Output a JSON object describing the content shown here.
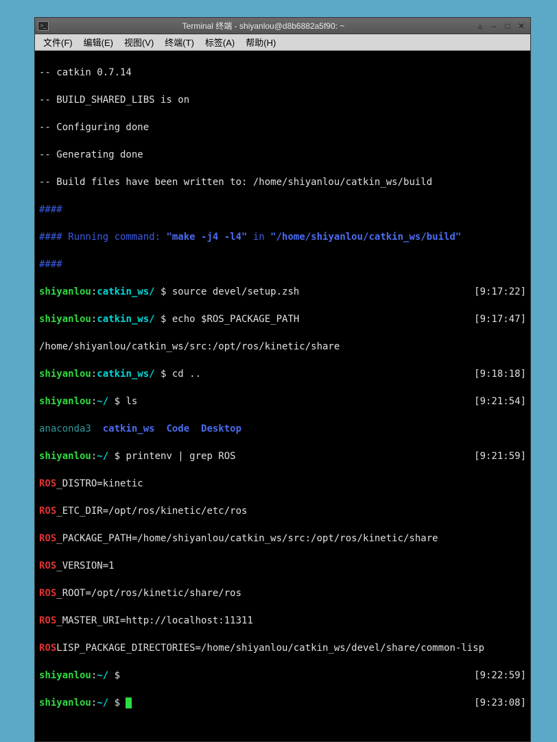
{
  "window": {
    "title": "Terminal 终端 - shiyanlou@d8b6882a5f90: ~"
  },
  "menu": {
    "file": "文件(F)",
    "edit": "编辑(E)",
    "view": "视图(V)",
    "terminal": "终端(T)",
    "tabs": "标签(A)",
    "help": "帮助(H)"
  },
  "lines": {
    "l1": "-- catkin 0.7.14",
    "l2": "-- BUILD_SHARED_LIBS is on",
    "l3": "-- Configuring done",
    "l4": "-- Generating done",
    "l5": "-- Build files have been written to: /home/shiyanlou/catkin_ws/build",
    "l6": "####",
    "l7a": "#### Running command: ",
    "l7b": "\"make -j4 -l4\"",
    "l7c": " in ",
    "l7d": "\"/home/shiyanlou/catkin_ws/build\"",
    "l8": "####",
    "p1_user": "shiyanlou",
    "p1_colon": ":",
    "p1_path": "catkin_ws/",
    "p1_rest": " $ source devel/setup.zsh",
    "p1_time": "[9:17:22]",
    "p2_rest": " $ echo $ROS_PACKAGE_PATH",
    "p2_time": "[9:17:47]",
    "l_path": "/home/shiyanlou/catkin_ws/src:/opt/ros/kinetic/share",
    "p3_rest": " $ cd ..",
    "p3_time": "[9:18:18]",
    "p4_path": "~/",
    "p4_rest": " $ ls",
    "p4_time": "[9:21:54]",
    "ls_ana": "anaconda3",
    "ls_cat": "catkin_ws",
    "ls_code": "Code",
    "ls_desk": "Desktop",
    "p5_rest": " $ printenv | grep ROS",
    "p5_time": "[9:21:59]",
    "r1a": "ROS",
    "r1b": "_DISTRO=kinetic",
    "r2b": "_ETC_DIR=/opt/ros/kinetic/etc/ros",
    "r3b": "_PACKAGE_PATH=/home/shiyanlou/catkin_ws/src:/opt/ros/kinetic/share",
    "r4b": "_VERSION=1",
    "r5b": "_ROOT=/opt/ros/kinetic/share/ros",
    "r6b": "_MASTER_URI=http://localhost:11311",
    "r7b": "LISP_PACKAGE_DIRECTORIES=/home/shiyanlou/catkin_ws/devel/share/common-lisp",
    "p6_rest": " $ ",
    "p6_time": "[9:22:59]",
    "p7_rest": " $ ",
    "p7_time": "[9:23:08]"
  }
}
